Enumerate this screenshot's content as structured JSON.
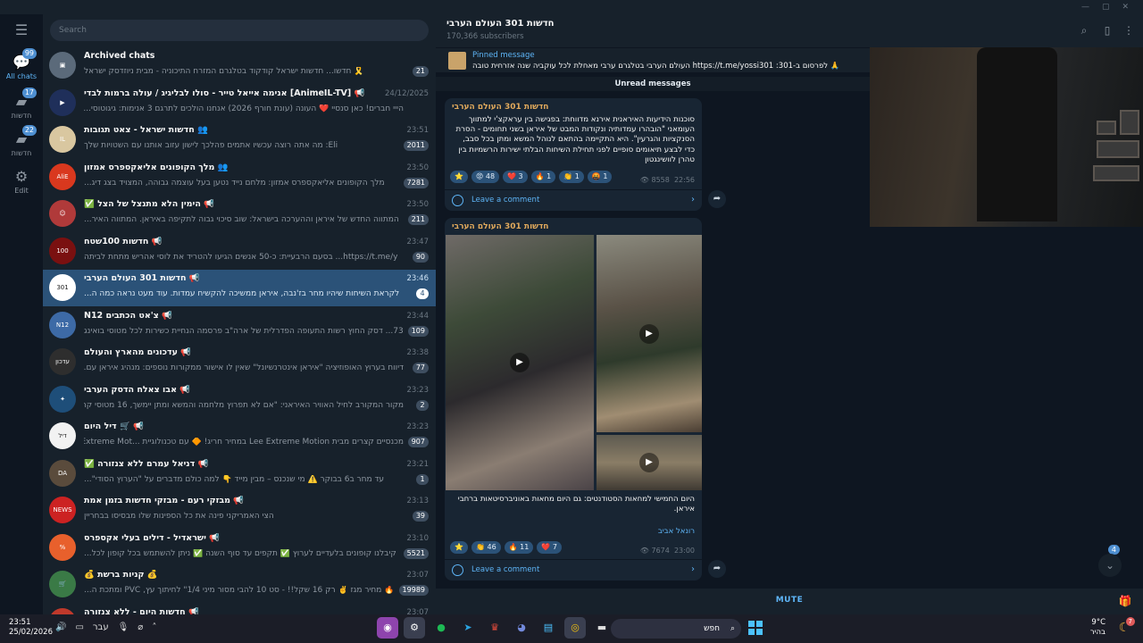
{
  "window": {
    "controls": [
      "—",
      "▢",
      "✕"
    ]
  },
  "rail": {
    "folders": [
      {
        "label": "All chats",
        "count": "99"
      },
      {
        "label": "חדשות",
        "count": "17"
      },
      {
        "label": "חדשות",
        "count": "22"
      },
      {
        "label": "Edit",
        "count": ""
      }
    ]
  },
  "search": {
    "placeholder": "Search"
  },
  "chats": [
    {
      "name": "Archived chats",
      "time": "",
      "msg": "🎗️ חדשו... חדשות ישראל קודקוד בטלגרם המזרח התיכוניה - מבית ניוזדסק ישראל",
      "badge": "21",
      "avatar_color": "#5b6a7a",
      "avatar_text": "▣"
    },
    {
      "name": "📢 [AnimeIL-TV] אנימה אייאל טייר - סולו לבליגיג / עולה ברמות לבדי",
      "time": "24/12/2025",
      "msg": "הייי חברים! כאן סנסיי ❤️ העונה (עונת חורף 2026) אנחנו הולכים לתרגם 3 אנימות: גיגוטוסי...",
      "badge": "",
      "avatar_color": "#1f2f5a",
      "avatar_text": "▶"
    },
    {
      "name": "👥 חדשות ישראל - צאט תגובות",
      "time": "23:51",
      "msg": "Eli: מה אתה רוצה עכשיו אתמים פהלכך לישון עזוב אותנו עם השטויות שלך",
      "badge": "2011",
      "avatar_color": "#d9c7a0",
      "avatar_text": "IL"
    },
    {
      "name": "👥 מלך הקופונים אליאקספרס אמזון",
      "time": "23:50",
      "msg": "מלך הקופונים אליאקספרס אמזון: מלחם נייד נטען בעל עוצמה גבוהה, המצויד בצג דיג...",
      "badge": "7281",
      "avatar_color": "#d9381e",
      "avatar_text": "AliE"
    },
    {
      "name": "📢 הימין הלא מתנצל של הצל ✅",
      "time": "23:50",
      "msg": "המתווה החדש של איראן וההערכה בישראל: שוב סיכוי גבוה לתקיפה באיראן. המתווה האיר...",
      "badge": "211",
      "avatar_color": "#b03a3a",
      "avatar_text": "☺"
    },
    {
      "name": "📢 חדשות 100שטח",
      "time": "23:47",
      "msg": "https://t.me/y... בסעם הרבעיית: כ-50 אנשים הגיעו להטריד את לוסי אהריש מתחת לביתה",
      "badge": "90",
      "avatar_color": "#7a1010",
      "avatar_text": "100"
    },
    {
      "name": "📢 חדשות 301 העולם הערבי",
      "time": "23:46",
      "msg": "לקראת השיחות שיהיו מחר בז'נבה, איראן ממשיכה להקשיח עמדות. עוד מעט נראה כמה ה...",
      "badge": "4",
      "avatar_color": "#ffffff",
      "avatar_text": "301"
    },
    {
      "name": "📢 צ'אט הכתבים N12",
      "time": "23:44",
      "msg": "73... דסק החוץ רשות התעופה הפדרלית של ארה\"ב פרסמה הנחיית כשירות לכל מטוסי בואינג",
      "badge": "109",
      "avatar_color": "#3d6aa6",
      "avatar_text": "N12"
    },
    {
      "name": "📢 עדכונים מהארץ והעולם",
      "time": "23:38",
      "msg": "דיווח בערוץ האופוזיציה \"איראן אינטרנשיונל\" שאין לו אישור ממקורות נוספים: מנהיג איראן עם...",
      "badge": "77",
      "avatar_color": "#2e2e2e",
      "avatar_text": "עדכון"
    },
    {
      "name": "📢 אבו צאלח הדסק הערבי",
      "time": "23:23",
      "msg": "מקור המקורב לחיל האוויר האיראני: \"אם לא תפרוץ מלחמה והמשא ומתן יימשך, 16 מטוסי קר...",
      "badge": "2",
      "avatar_color": "#1e4e79",
      "avatar_text": "✦"
    },
    {
      "name": "📢 🛒 דיל היום",
      "time": "23:23",
      "msg": "מכנסיים קצרים מבית Lee Extreme Motion במחיר חריג! 🔶 עם טכנולוגיית ...Extreme Mot",
      "badge": "907",
      "avatar_color": "#f2f2f2",
      "avatar_text": "דיל"
    },
    {
      "name": "📢 דניאל עמרם ללא צנזורה ✅",
      "time": "23:21",
      "msg": "עד מחר ב6 בבוקר ⚠️ מי שנכנס – מבין מייד 👇 למה כולם מדברים על \"הערוץ הסודי\"...",
      "badge": "1",
      "avatar_color": "#5a4b3c",
      "avatar_text": "DA"
    },
    {
      "name": "📢 מבזקי רעם - מבזקי חדשות בזמן אמת",
      "time": "23:13",
      "msg": "הצי האמריקני פינה את כל הספינות שלו מבסיסו בבחריין",
      "badge": "39",
      "avatar_color": "#cc2222",
      "avatar_text": "NEWS"
    },
    {
      "name": "📢 ישראדיל - דילים בעלי אקספרס",
      "time": "23:10",
      "msg": "קיבלנו קופונים בלעדיים לערוץ ✅ תקפים עד סוף השנה ✅ ניתן להשתמש בכל קופון לכל...",
      "badge": "5521",
      "avatar_color": "#e8602c",
      "avatar_text": "%"
    },
    {
      "name": "💰 קניות ברשת 💰",
      "time": "23:07",
      "msg": "🔥 מחיר מגז ✌️ רק 16 שקל!! - סט 10 להבי מסור מיני 1/4\" לחיתוך עץ, PVC ומתכת ה...",
      "badge": "19989",
      "avatar_color": "#3a7a46",
      "avatar_text": "🛒"
    },
    {
      "name": "📢 חדשות היום - ללא צנזורה",
      "time": "23:07",
      "msg": "",
      "badge": "",
      "avatar_color": "#c0392b",
      "avatar_text": ""
    }
  ],
  "chat": {
    "title": "חדשות 301 העולם הערבי",
    "subtitle": "170,366 subscribers",
    "pinned_label": "Pinned message",
    "pinned_text": "🙏 לפרסום ב-301: https://t.me/yossi301 העולם הערבי בטלגרם ערבי מאחלת לכל עוקביה שנה אזרחית טובה",
    "unread_label": "Unread messages",
    "mute_label": "MUTE",
    "scroll_badge": "4"
  },
  "posts": [
    {
      "channel": "חדשות 301 העולם הערבי",
      "text": "סוכנות הידיעות האיראנית אירנא מדווחת: בפגישה בין עראקצ'י למתווך העומאני \"הובהרו עמדותיה ונקודות המבט של איראן בשני תחומים - הסרת הסנקציות והגרעין\". היא התקיימה בהתאם לנוהל המשא ומתן בכל סבב, כדי לבצע תיאומים סופיים לפני תחילת השיחות הבלתי ישירות הרשמיות בין טהרן לוושינגטון",
      "reactions": [
        "⭐",
        "😡 48",
        "❤️ 3",
        "🔥 1",
        "👏 1",
        "🤬 1"
      ],
      "views": "8558",
      "time": "22:56",
      "comment_label": "Leave a comment"
    },
    {
      "channel": "חדשות 301 העולם הערבי",
      "text": "היום החמישי למחאות הסטודנטים: גם היום מחאות באוניברסיטאות ברחבי איראן.",
      "signature": "רונאל אביב",
      "reactions": [
        "⭐",
        "👏 46",
        "🔥 11",
        "❤️ 7"
      ],
      "views": "7674",
      "time": "23:00",
      "comment_label": "Leave a comment"
    }
  ],
  "taskbar": {
    "time": "23:51",
    "date": "25/02/2026",
    "lang": "עבר",
    "search_label": "חפש",
    "temp": "9°C",
    "weather_text": "בהיר",
    "notif_count": "7"
  },
  "colors": {
    "accent": "#5eb5f7",
    "active_row": "#2b5278",
    "channel_name": "#e0a95c",
    "panel": "#17212b",
    "background": "#0e1621"
  }
}
